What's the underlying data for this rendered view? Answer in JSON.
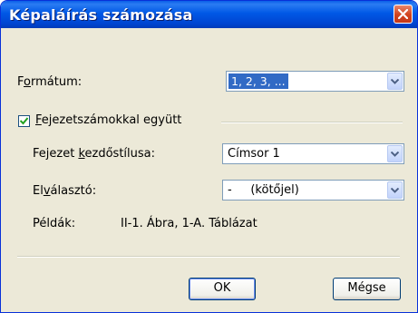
{
  "dialog": {
    "title": "Képaláírás számozása"
  },
  "format": {
    "label_prefix": "F",
    "label_accel": "o",
    "label_rest": "rmátum:",
    "value": "1, 2, 3, ..."
  },
  "chapter_numbers": {
    "checked": true,
    "label_accel": "F",
    "label_rest": "ejezetszámokkal együtt"
  },
  "chapter_style": {
    "label_prefix": "Fejezet ",
    "label_accel": "k",
    "label_rest": "ezdőstílusa:",
    "value": "Címsor 1"
  },
  "separator": {
    "label_prefix": "El",
    "label_accel": "v",
    "label_rest": "álasztó:",
    "value": "-     (kötőjel)"
  },
  "examples": {
    "label": "Példák:",
    "value": "II-1. Ábra, 1-A. Táblázat"
  },
  "buttons": {
    "ok": "OK",
    "cancel": "Mégse"
  },
  "colors": {
    "titlebar": "#0058e6",
    "close": "#d1421c",
    "selection": "#316ac5",
    "checkmark": "#21a121"
  }
}
